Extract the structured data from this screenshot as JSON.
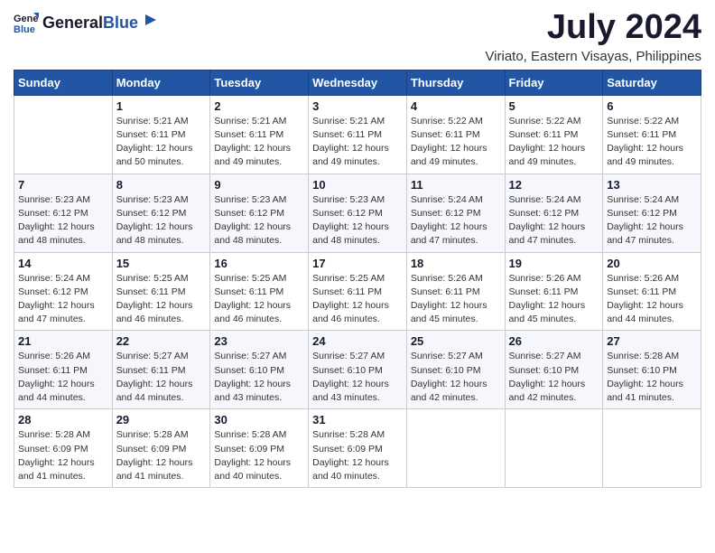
{
  "header": {
    "logo_general": "General",
    "logo_blue": "Blue",
    "month_title": "July 2024",
    "location": "Viriato, Eastern Visayas, Philippines"
  },
  "calendar": {
    "days_of_week": [
      "Sunday",
      "Monday",
      "Tuesday",
      "Wednesday",
      "Thursday",
      "Friday",
      "Saturday"
    ],
    "weeks": [
      [
        {
          "day": "",
          "info": ""
        },
        {
          "day": "1",
          "info": "Sunrise: 5:21 AM\nSunset: 6:11 PM\nDaylight: 12 hours\nand 50 minutes."
        },
        {
          "day": "2",
          "info": "Sunrise: 5:21 AM\nSunset: 6:11 PM\nDaylight: 12 hours\nand 49 minutes."
        },
        {
          "day": "3",
          "info": "Sunrise: 5:21 AM\nSunset: 6:11 PM\nDaylight: 12 hours\nand 49 minutes."
        },
        {
          "day": "4",
          "info": "Sunrise: 5:22 AM\nSunset: 6:11 PM\nDaylight: 12 hours\nand 49 minutes."
        },
        {
          "day": "5",
          "info": "Sunrise: 5:22 AM\nSunset: 6:11 PM\nDaylight: 12 hours\nand 49 minutes."
        },
        {
          "day": "6",
          "info": "Sunrise: 5:22 AM\nSunset: 6:11 PM\nDaylight: 12 hours\nand 49 minutes."
        }
      ],
      [
        {
          "day": "7",
          "info": "Sunrise: 5:23 AM\nSunset: 6:12 PM\nDaylight: 12 hours\nand 48 minutes."
        },
        {
          "day": "8",
          "info": "Sunrise: 5:23 AM\nSunset: 6:12 PM\nDaylight: 12 hours\nand 48 minutes."
        },
        {
          "day": "9",
          "info": "Sunrise: 5:23 AM\nSunset: 6:12 PM\nDaylight: 12 hours\nand 48 minutes."
        },
        {
          "day": "10",
          "info": "Sunrise: 5:23 AM\nSunset: 6:12 PM\nDaylight: 12 hours\nand 48 minutes."
        },
        {
          "day": "11",
          "info": "Sunrise: 5:24 AM\nSunset: 6:12 PM\nDaylight: 12 hours\nand 47 minutes."
        },
        {
          "day": "12",
          "info": "Sunrise: 5:24 AM\nSunset: 6:12 PM\nDaylight: 12 hours\nand 47 minutes."
        },
        {
          "day": "13",
          "info": "Sunrise: 5:24 AM\nSunset: 6:12 PM\nDaylight: 12 hours\nand 47 minutes."
        }
      ],
      [
        {
          "day": "14",
          "info": "Sunrise: 5:24 AM\nSunset: 6:12 PM\nDaylight: 12 hours\nand 47 minutes."
        },
        {
          "day": "15",
          "info": "Sunrise: 5:25 AM\nSunset: 6:11 PM\nDaylight: 12 hours\nand 46 minutes."
        },
        {
          "day": "16",
          "info": "Sunrise: 5:25 AM\nSunset: 6:11 PM\nDaylight: 12 hours\nand 46 minutes."
        },
        {
          "day": "17",
          "info": "Sunrise: 5:25 AM\nSunset: 6:11 PM\nDaylight: 12 hours\nand 46 minutes."
        },
        {
          "day": "18",
          "info": "Sunrise: 5:26 AM\nSunset: 6:11 PM\nDaylight: 12 hours\nand 45 minutes."
        },
        {
          "day": "19",
          "info": "Sunrise: 5:26 AM\nSunset: 6:11 PM\nDaylight: 12 hours\nand 45 minutes."
        },
        {
          "day": "20",
          "info": "Sunrise: 5:26 AM\nSunset: 6:11 PM\nDaylight: 12 hours\nand 44 minutes."
        }
      ],
      [
        {
          "day": "21",
          "info": "Sunrise: 5:26 AM\nSunset: 6:11 PM\nDaylight: 12 hours\nand 44 minutes."
        },
        {
          "day": "22",
          "info": "Sunrise: 5:27 AM\nSunset: 6:11 PM\nDaylight: 12 hours\nand 44 minutes."
        },
        {
          "day": "23",
          "info": "Sunrise: 5:27 AM\nSunset: 6:10 PM\nDaylight: 12 hours\nand 43 minutes."
        },
        {
          "day": "24",
          "info": "Sunrise: 5:27 AM\nSunset: 6:10 PM\nDaylight: 12 hours\nand 43 minutes."
        },
        {
          "day": "25",
          "info": "Sunrise: 5:27 AM\nSunset: 6:10 PM\nDaylight: 12 hours\nand 42 minutes."
        },
        {
          "day": "26",
          "info": "Sunrise: 5:27 AM\nSunset: 6:10 PM\nDaylight: 12 hours\nand 42 minutes."
        },
        {
          "day": "27",
          "info": "Sunrise: 5:28 AM\nSunset: 6:10 PM\nDaylight: 12 hours\nand 41 minutes."
        }
      ],
      [
        {
          "day": "28",
          "info": "Sunrise: 5:28 AM\nSunset: 6:09 PM\nDaylight: 12 hours\nand 41 minutes."
        },
        {
          "day": "29",
          "info": "Sunrise: 5:28 AM\nSunset: 6:09 PM\nDaylight: 12 hours\nand 41 minutes."
        },
        {
          "day": "30",
          "info": "Sunrise: 5:28 AM\nSunset: 6:09 PM\nDaylight: 12 hours\nand 40 minutes."
        },
        {
          "day": "31",
          "info": "Sunrise: 5:28 AM\nSunset: 6:09 PM\nDaylight: 12 hours\nand 40 minutes."
        },
        {
          "day": "",
          "info": ""
        },
        {
          "day": "",
          "info": ""
        },
        {
          "day": "",
          "info": ""
        }
      ]
    ]
  }
}
